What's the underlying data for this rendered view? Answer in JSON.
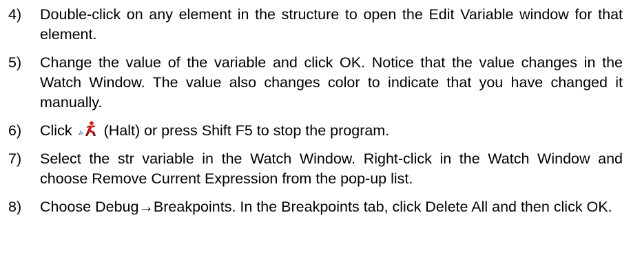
{
  "steps": [
    {
      "number": "4)",
      "text": "Double-click on any element in the structure to open the Edit Variable window for that element."
    },
    {
      "number": "5)",
      "text": "Change the value of the variable and click OK. Notice that the value changes in the Watch Window. The value also changes color to indicate that you have changed it manually."
    },
    {
      "number": "6)",
      "text_before_icon": "Click",
      "icon": "halt-icon",
      "text_after_icon": "(Halt) or press Shift F5 to stop the program."
    },
    {
      "number": "7)",
      "text": "Select the str variable in the Watch Window. Right-click in the Watch Window and choose Remove Current Expression from the pop-up list."
    },
    {
      "number": "8)",
      "text": "Choose Debug→Breakpoints. In the Breakpoints tab, click Delete All and then click OK."
    }
  ],
  "colors": {
    "text": "#000000",
    "icon_red": "#cc1a1a",
    "icon_dark": "#7a1010",
    "icon_dots": "#5a8fc0"
  }
}
